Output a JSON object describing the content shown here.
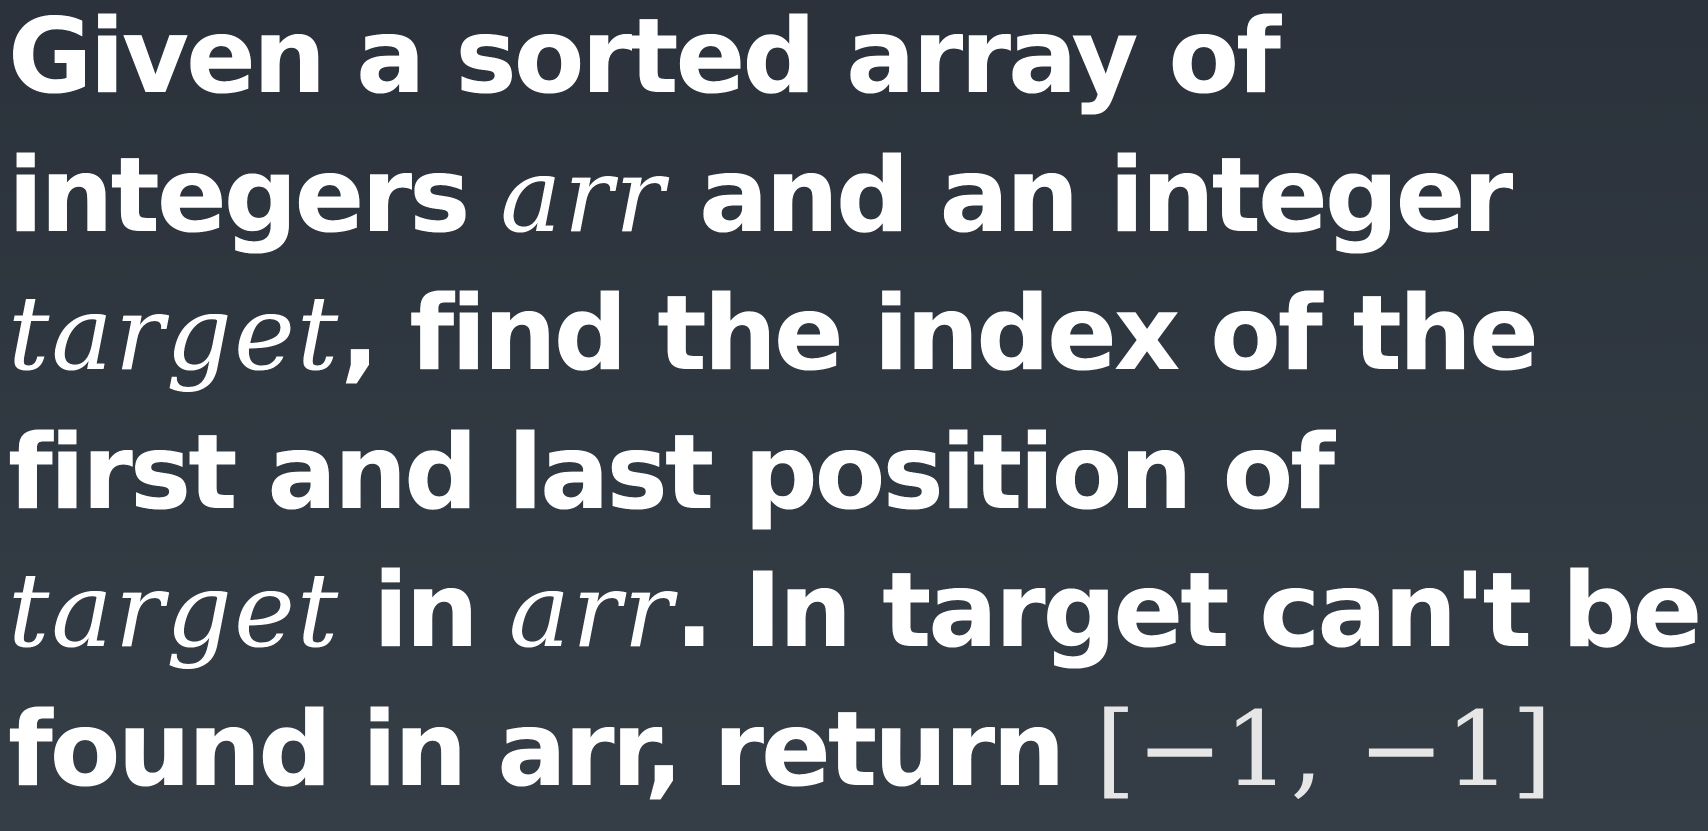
{
  "problem": {
    "line1": {
      "text": "Given a sorted array of"
    },
    "line2": {
      "pre": "integers ",
      "var": "arr",
      "post": " and an integer"
    },
    "line3": {
      "var": "target",
      "post": ", find the index of the"
    },
    "line4": {
      "text": "first and last position of"
    },
    "line5": {
      "var1": "target",
      "mid": " in ",
      "var2": "arr",
      "post": ". In target can't be"
    },
    "line6": {
      "pre": "found in arr, return ",
      "math": "[−1, −1]"
    }
  }
}
